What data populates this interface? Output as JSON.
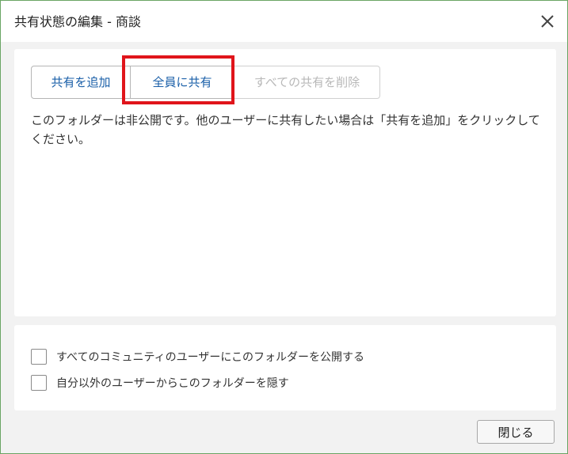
{
  "dialog": {
    "title": "共有状態の編集 - 商談",
    "close_icon": "close-icon"
  },
  "sharing": {
    "add_share_label": "共有を追加",
    "share_all_label": "全員に共有",
    "remove_all_label": "すべての共有を削除",
    "description": "このフォルダーは非公開です。他のユーザーに共有したい場合は「共有を追加」をクリックしてください。"
  },
  "options": {
    "publish_community": "すべてのコミュニティのユーザーにこのフォルダーを公開する",
    "hide_from_others": "自分以外のユーザーからこのフォルダーを隠す"
  },
  "footer": {
    "close_label": "閉じる"
  },
  "colors": {
    "accent_text": "#1a5fa8",
    "highlight_border": "#e0151b",
    "window_border": "#6aa564"
  }
}
